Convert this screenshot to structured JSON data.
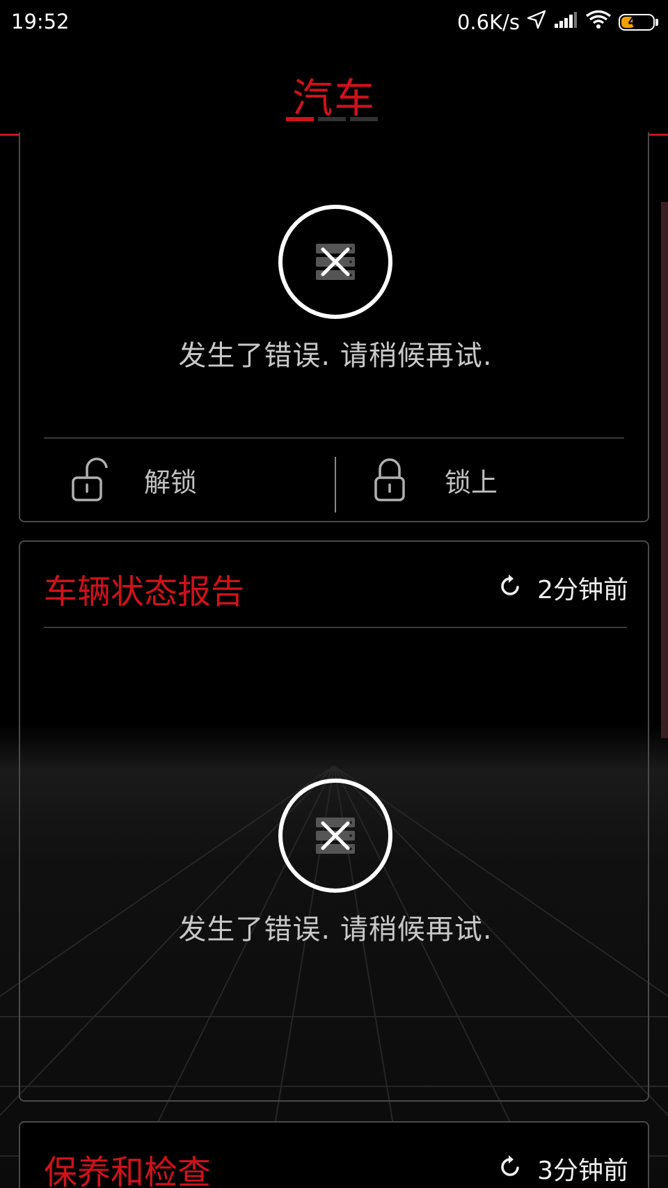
{
  "status_bar": {
    "time": "19:52",
    "network_speed": "0.6K/s",
    "battery_level": "48",
    "battery_fill_pct": 48,
    "icons": [
      "location-arrow-icon",
      "signal-icon",
      "wifi-icon",
      "battery-icon"
    ]
  },
  "header": {
    "title": "汽车",
    "pages_total": 3,
    "active_page": 1
  },
  "lock_card": {
    "error_text": "发生了错误. 请稍候再试.",
    "unlock_label": "解锁",
    "lock_label": "锁上",
    "icons": [
      "server-error-icon",
      "unlock-icon",
      "lock-icon"
    ]
  },
  "status_card": {
    "title": "车辆状态报告",
    "updated": "2分钟前",
    "error_text": "发生了错误. 请稍候再试.",
    "icons": [
      "refresh-icon",
      "server-error-icon"
    ]
  },
  "maintenance_card": {
    "title": "保养和检查",
    "updated": "3分钟前",
    "icons": [
      "refresh-icon"
    ]
  },
  "colors": {
    "accent": "#d0111b",
    "background": "#000000",
    "battery": "#f0a000"
  }
}
